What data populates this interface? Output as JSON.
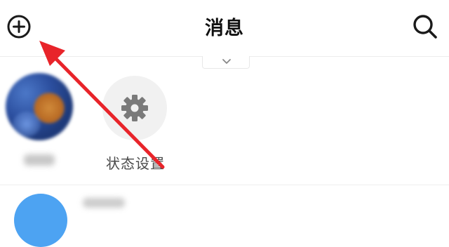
{
  "header": {
    "title": "消息",
    "add_icon": "plus-circle-icon",
    "search_icon": "search-icon"
  },
  "pull_tab": {
    "icon": "chevron-down-icon"
  },
  "status_row": {
    "settings_label": "状态设置",
    "settings_icon": "gear-icon"
  },
  "annotation": {
    "color": "#e8242a",
    "icon": "arrow-icon"
  },
  "colors": {
    "accent_blue": "#4da3f2",
    "annotation_red": "#e8242a",
    "gear_gray": "#7a7a7a"
  }
}
